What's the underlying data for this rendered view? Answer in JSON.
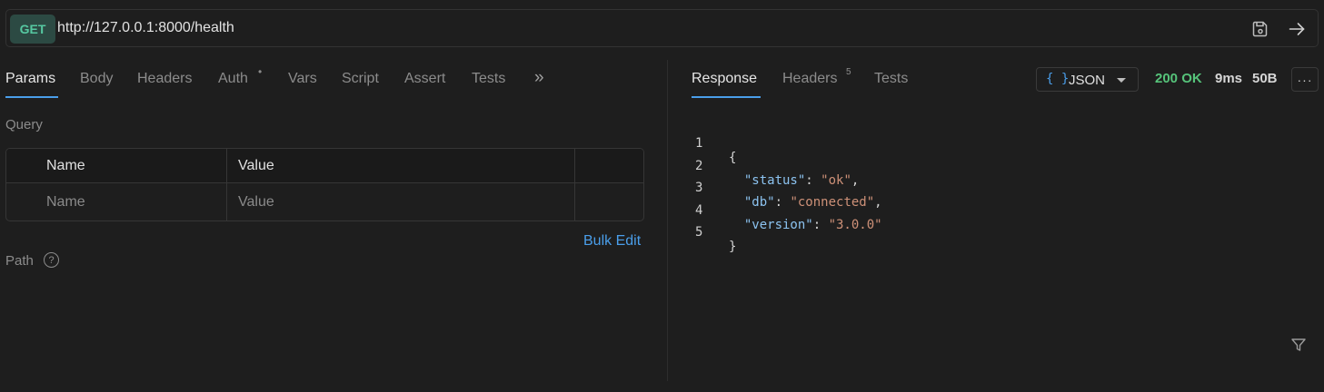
{
  "request": {
    "method": "GET",
    "url": "http://127.0.0.1:8000/health"
  },
  "request_tabs": [
    {
      "label": "Params",
      "active": true
    },
    {
      "label": "Body"
    },
    {
      "label": "Headers"
    },
    {
      "label": "Auth",
      "indicator": "•"
    },
    {
      "label": "Vars"
    },
    {
      "label": "Script"
    },
    {
      "label": "Assert"
    },
    {
      "label": "Tests"
    },
    {
      "label": "»"
    }
  ],
  "params": {
    "query_label": "Query",
    "columns": [
      "Name",
      "Value"
    ],
    "placeholder_row": [
      "Name",
      "Value"
    ],
    "bulk_edit": "Bulk Edit",
    "path_label": "Path",
    "help": "?"
  },
  "response_tabs": [
    {
      "label": "Response",
      "active": true
    },
    {
      "label": "Headers",
      "count": "5"
    },
    {
      "label": "Tests"
    }
  ],
  "response": {
    "format_icon": "{ }",
    "format": "JSON",
    "status": "200 OK",
    "time": "9ms",
    "size": "50B",
    "more": "···",
    "lines": [
      {
        "n": "1",
        "indent": "",
        "key": "",
        "value": "",
        "text": "{"
      },
      {
        "n": "2",
        "indent": "  ",
        "key": "\"status\"",
        "value": "\"ok\"",
        "comma": ","
      },
      {
        "n": "3",
        "indent": "  ",
        "key": "\"db\"",
        "value": "\"connected\"",
        "comma": ","
      },
      {
        "n": "4",
        "indent": "  ",
        "key": "\"version\"",
        "value": "\"3.0.0\"",
        "comma": ""
      },
      {
        "n": "5",
        "indent": "",
        "key": "",
        "value": "",
        "text": "}"
      }
    ]
  },
  "colors": {
    "accent": "#4a9eea",
    "method": "#56c8a1",
    "status_ok": "#56c37a",
    "json_key": "#8cc3f0",
    "json_string": "#ce9178"
  },
  "icons": [
    "save-icon",
    "send-arrow-icon",
    "chevrons-right-icon",
    "help-circle-icon",
    "json-braces-icon",
    "chevron-down-icon",
    "more-horizontal-icon",
    "filter-icon"
  ]
}
